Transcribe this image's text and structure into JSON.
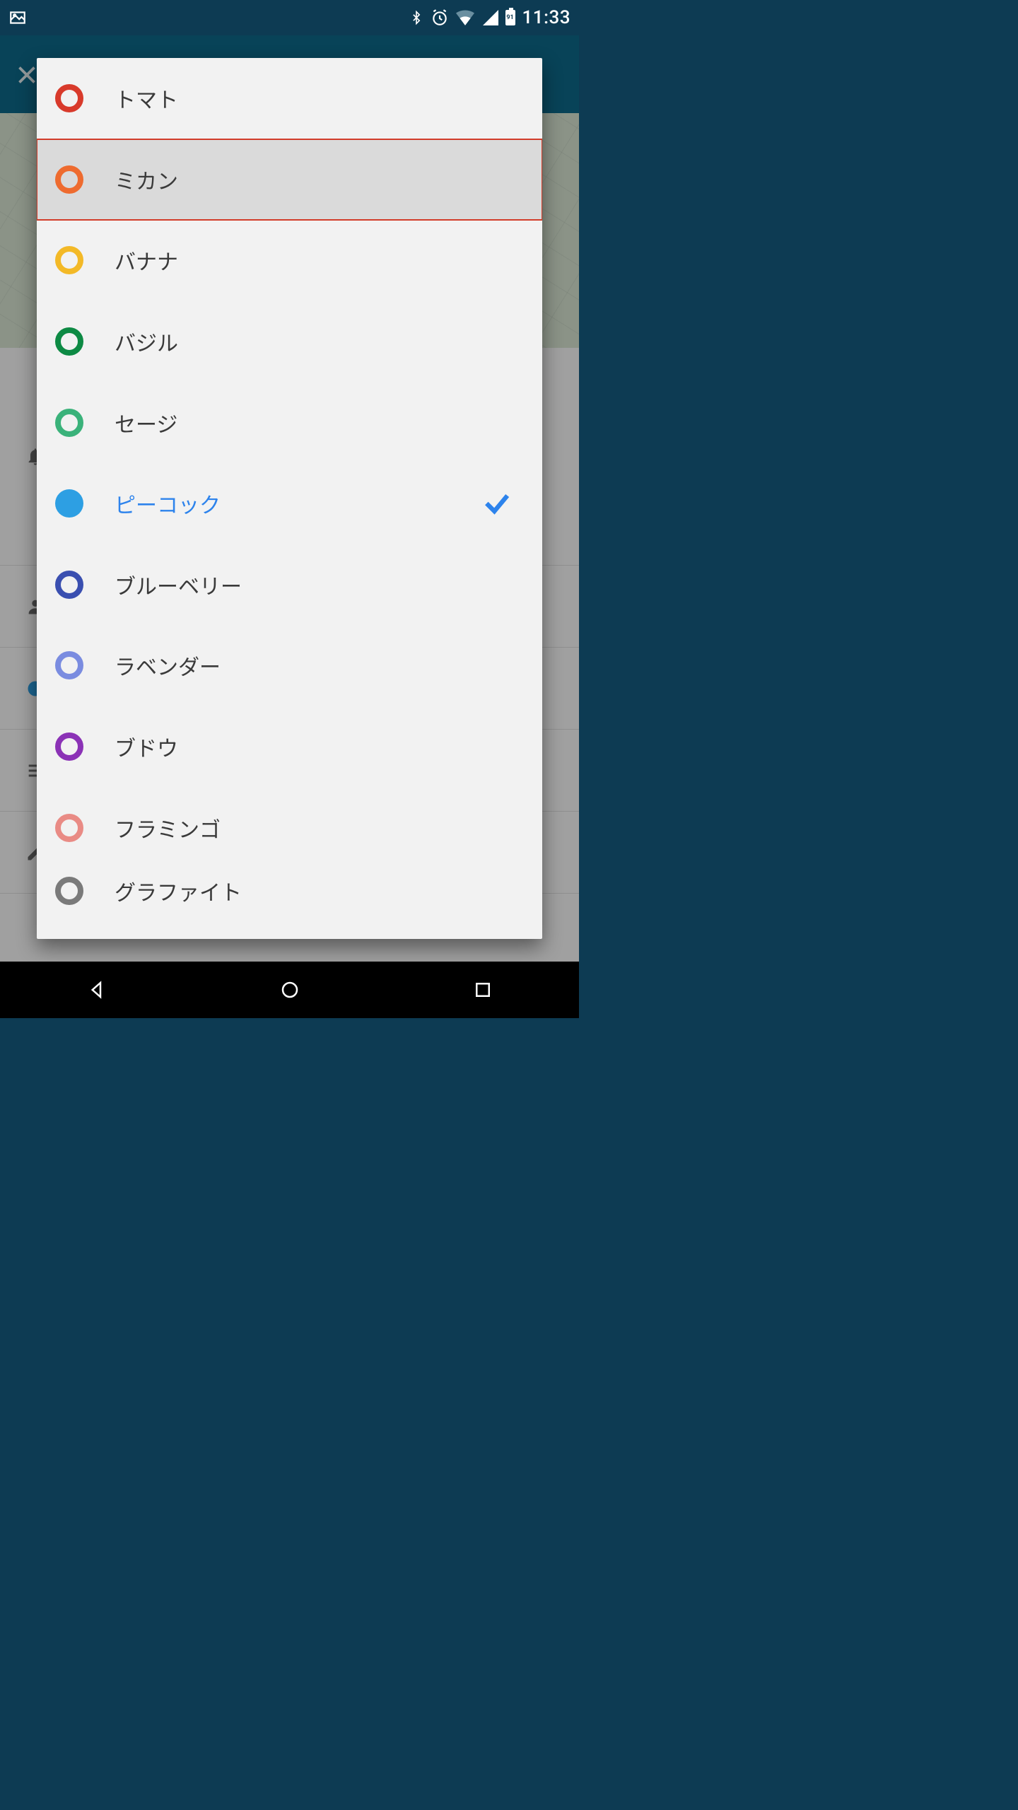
{
  "status": {
    "time": "11:33",
    "battery": "91"
  },
  "colors": [
    {
      "key": "tomato",
      "label": "トマト",
      "hex": "#D83A2B",
      "selected": false,
      "highlight": false
    },
    {
      "key": "tangerine",
      "label": "ミカン",
      "hex": "#EE6B2F",
      "selected": false,
      "highlight": true
    },
    {
      "key": "banana",
      "label": "バナナ",
      "hex": "#F3B927",
      "selected": false,
      "highlight": false
    },
    {
      "key": "basil",
      "label": "バジル",
      "hex": "#0D8A44",
      "selected": false,
      "highlight": false
    },
    {
      "key": "sage",
      "label": "セージ",
      "hex": "#3AB27A",
      "selected": false,
      "highlight": false
    },
    {
      "key": "peacock",
      "label": "ピーコック",
      "hex": "#2D9FE3",
      "selected": true,
      "highlight": false
    },
    {
      "key": "blueberry",
      "label": "ブルーベリー",
      "hex": "#3A4FB0",
      "selected": false,
      "highlight": false
    },
    {
      "key": "lavender",
      "label": "ラベンダー",
      "hex": "#7A8CE0",
      "selected": false,
      "highlight": false
    },
    {
      "key": "grape",
      "label": "ブドウ",
      "hex": "#8B32B6",
      "selected": false,
      "highlight": false
    },
    {
      "key": "flamingo",
      "label": "フラミンゴ",
      "hex": "#E98B85",
      "selected": false,
      "highlight": false
    },
    {
      "key": "graphite",
      "label": "グラファイト",
      "hex": "#7A7A7A",
      "selected": false,
      "highlight": false
    }
  ]
}
